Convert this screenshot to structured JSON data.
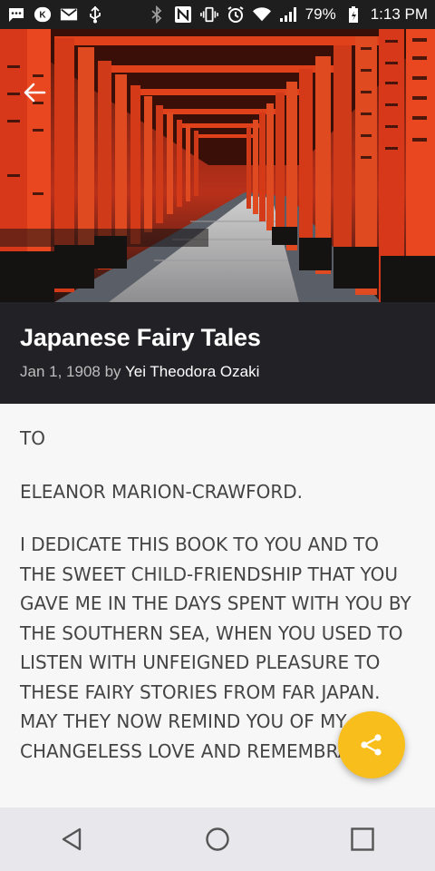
{
  "status_bar": {
    "battery_percent": "79%",
    "time": "1:13 PM",
    "icons": [
      "chat-icon",
      "kaspersky-icon",
      "gmail-icon",
      "usb-icon",
      "bluetooth-icon",
      "nfc-icon",
      "vibrate-icon",
      "alarm-icon",
      "wifi-icon",
      "signal-icon",
      "battery-icon"
    ]
  },
  "header": {
    "back_icon": "arrow-back-icon",
    "image": "torii-gates-photo"
  },
  "book": {
    "title": "Japanese Fairy Tales",
    "date": "Jan 1, 1908",
    "by": "by",
    "author": "Yei Theodora Ozaki"
  },
  "content": {
    "paragraphs": [
      "TO",
      "ELEANOR MARION-CRAWFORD.",
      "I DEDICATE THIS BOOK TO YOU AND TO THE SWEET CHILD-FRIENDSHIP THAT YOU GAVE ME IN THE DAYS SPENT WITH YOU BY THE SOUTHERN SEA, WHEN YOU USED TO LISTEN WITH UNFEIGNED PLEASURE TO THESE FAIRY STORIES FROM FAR JAPAN. MAY THEY NOW REMIND YOU OF MY CHANGELESS LOVE AND REMEMBRANCE."
    ]
  },
  "fab": {
    "icon": "share-icon",
    "color": "#f8be1b"
  },
  "nav": {
    "icons": [
      "back-triangle-icon",
      "home-circle-icon",
      "recents-square-icon"
    ]
  },
  "colors": {
    "title_bar": "#222226",
    "content_bg": "#f7f7f7",
    "torii_orange": "#e0401a"
  }
}
